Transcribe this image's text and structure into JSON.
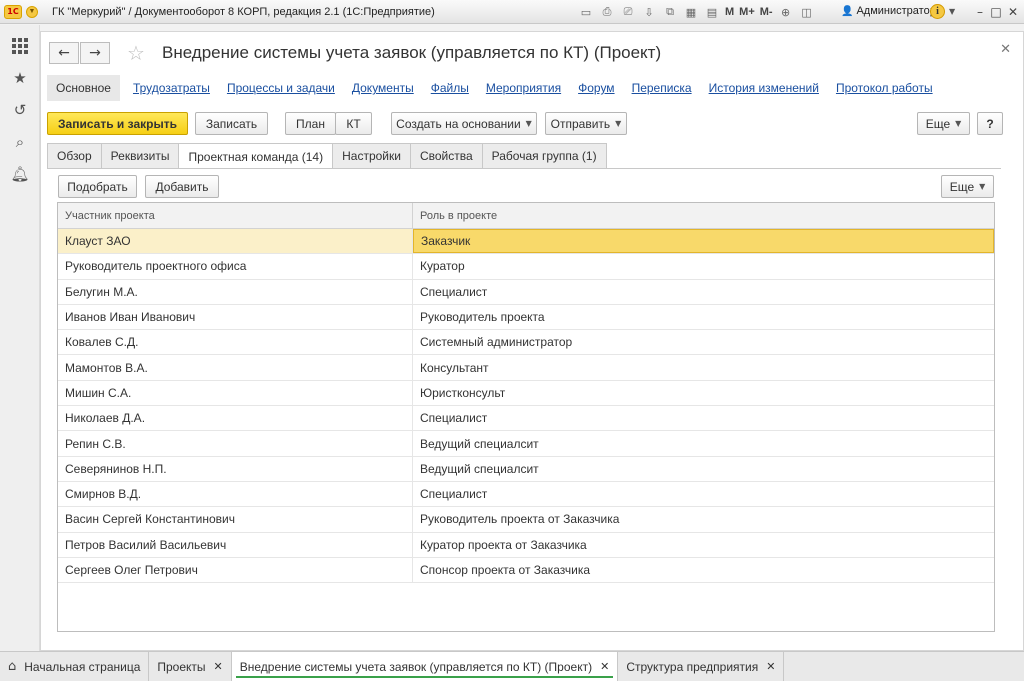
{
  "window": {
    "title": "ГК \"Меркурий\" / Документооборот 8 КОРП, редакция 2.1  (1С:Предприятие)",
    "logo_text": "1С",
    "user": "Администратор",
    "toolbar_text_buttons": [
      "M",
      "M+",
      "M-"
    ]
  },
  "form": {
    "title": "Внедрение системы учета заявок (управляется по КТ) (Проект)",
    "nav_links": {
      "active": "Основное",
      "items": [
        "Трудозатраты",
        "Процессы и задачи",
        "Документы",
        "Файлы",
        "Мероприятия",
        "Форум",
        "Переписка",
        "История изменений",
        "Протокол работы"
      ]
    },
    "buttons": {
      "save_close": "Записать и закрыть",
      "save": "Записать",
      "plan": "План",
      "kt": "КТ",
      "create_based": "Создать на основании",
      "send": "Отправить",
      "more": "Еще",
      "help": "?"
    },
    "tabs": [
      "Обзор",
      "Реквизиты",
      "Проектная команда (14)",
      "Настройки",
      "Свойства",
      "Рабочая группа (1)"
    ],
    "selected_tab": "Проектная команда (14)",
    "team": {
      "buttons": {
        "pick": "Подобрать",
        "add": "Добавить",
        "more": "Еще"
      },
      "columns": [
        "Участник проекта",
        "Роль в проекте"
      ],
      "rows": [
        {
          "member": "Клауст ЗАО",
          "role": "Заказчик"
        },
        {
          "member": "Руководитель проектного офиса",
          "role": "Куратор"
        },
        {
          "member": "Белугин М.А.",
          "role": "Специалист"
        },
        {
          "member": "Иванов Иван Иванович",
          "role": "Руководитель проекта"
        },
        {
          "member": "Ковалев С.Д.",
          "role": "Системный администратор"
        },
        {
          "member": "Мамонтов В.А.",
          "role": "Консультант"
        },
        {
          "member": "Мишин С.А.",
          "role": "Юристконсульт"
        },
        {
          "member": "Николаев Д.А.",
          "role": "Специалист"
        },
        {
          "member": "Репин С.В.",
          "role": "Ведущий специалсит"
        },
        {
          "member": "Северянинов Н.П.",
          "role": "Ведущий специалсит"
        },
        {
          "member": "Смирнов В.Д.",
          "role": "Специалист"
        },
        {
          "member": "Васин Сергей Константинович",
          "role": "Руководитель проекта от Заказчика"
        },
        {
          "member": "Петров Василий Васильевич",
          "role": "Куратор проекта от Заказчика"
        },
        {
          "member": "Сергеев Олег Петрович",
          "role": "Спонсор проекта от Заказчика"
        }
      ]
    }
  },
  "bottom_tabs": {
    "home": "Начальная страница",
    "items": [
      "Проекты",
      "Внедрение системы учета заявок (управляется по КТ) (Проект)",
      "Структура предприятия"
    ],
    "active": "Внедрение системы учета заявок (управляется по КТ) (Проект)"
  },
  "colors": {
    "primary_button": "#f6cf15",
    "selected_row": "#fbf0c9",
    "selected_cell": "#f8d96a",
    "link": "#1a4fa0",
    "active_tab_underline": "#3aa14a"
  }
}
